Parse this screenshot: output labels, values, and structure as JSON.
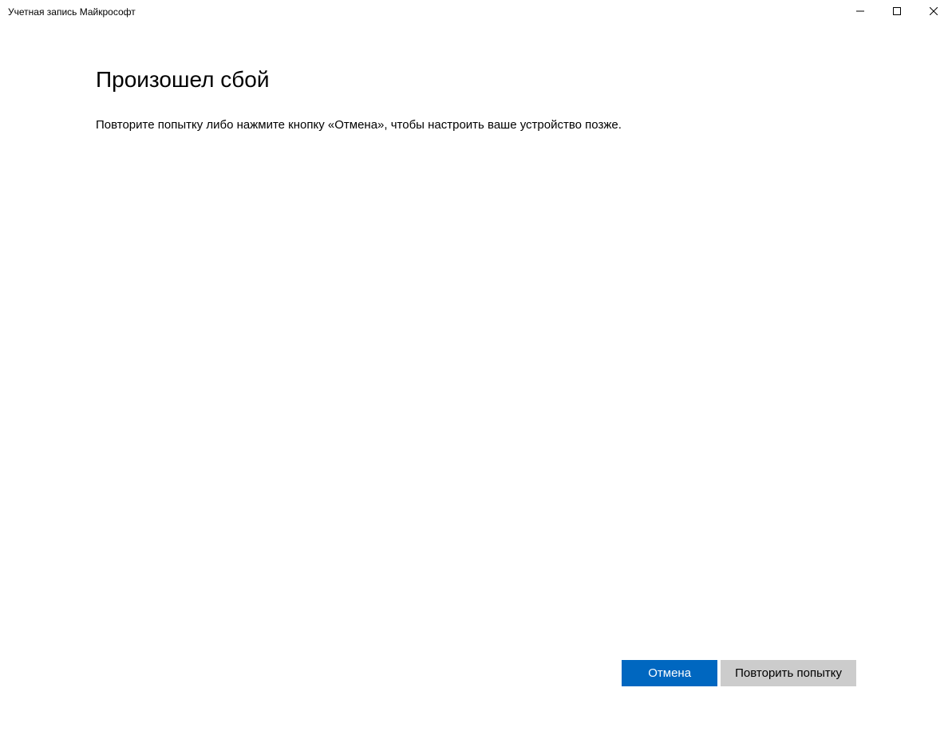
{
  "window": {
    "title": "Учетная запись Майкрософт"
  },
  "main": {
    "heading": "Произошел сбой",
    "message": "Повторите попытку либо нажмите кнопку «Отмена», чтобы настроить ваше устройство позже."
  },
  "footer": {
    "cancel_label": "Отмена",
    "retry_label": "Повторить попытку"
  }
}
